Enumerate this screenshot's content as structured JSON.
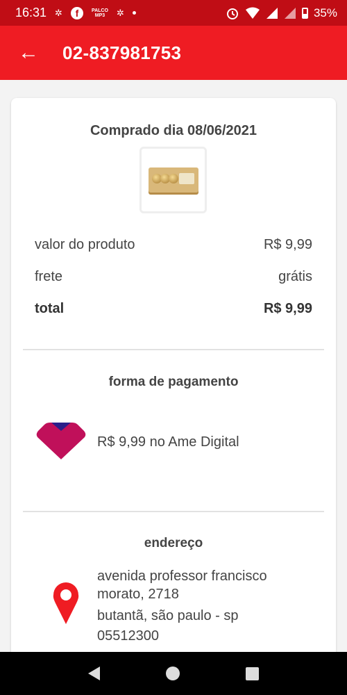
{
  "status_bar": {
    "time": "16:31",
    "notification_icons": [
      "settings-icon",
      "facebook-icon",
      "palco-mp3-icon",
      "settings-icon",
      "dot-icon"
    ],
    "palco_label_top": "PALCO",
    "palco_label_bottom": "MP3",
    "facebook_glyph": "f",
    "battery": "35%"
  },
  "header": {
    "title": "02-837981753",
    "back_icon": "back-arrow-icon"
  },
  "order": {
    "purchase_date": "Comprado dia 08/06/2021",
    "product_image": "product-chocolate-box"
  },
  "summary": {
    "product_value_label": "valor do produto",
    "product_value": "R$ 9,99",
    "shipping_label": "frete",
    "shipping_value": "grátis",
    "total_label": "total",
    "total_value": "R$ 9,99"
  },
  "payment": {
    "title": "forma de pagamento",
    "text": "R$ 9,99 no Ame Digital",
    "logo": "ame-digital-logo",
    "logo_colors": [
      "#c0105a",
      "#2a1f8a"
    ]
  },
  "address": {
    "title": "endereço",
    "line1": "avenida professor francisco",
    "line2": "morato, 2718",
    "line3": "butantã, são paulo - sp",
    "line4": "05512300",
    "icon": "location-pin-icon",
    "icon_color": "#ef1c23"
  },
  "colors": {
    "status_bar": "#c00d15",
    "app_bar": "#ef1c23",
    "background": "#f3f3f3"
  }
}
